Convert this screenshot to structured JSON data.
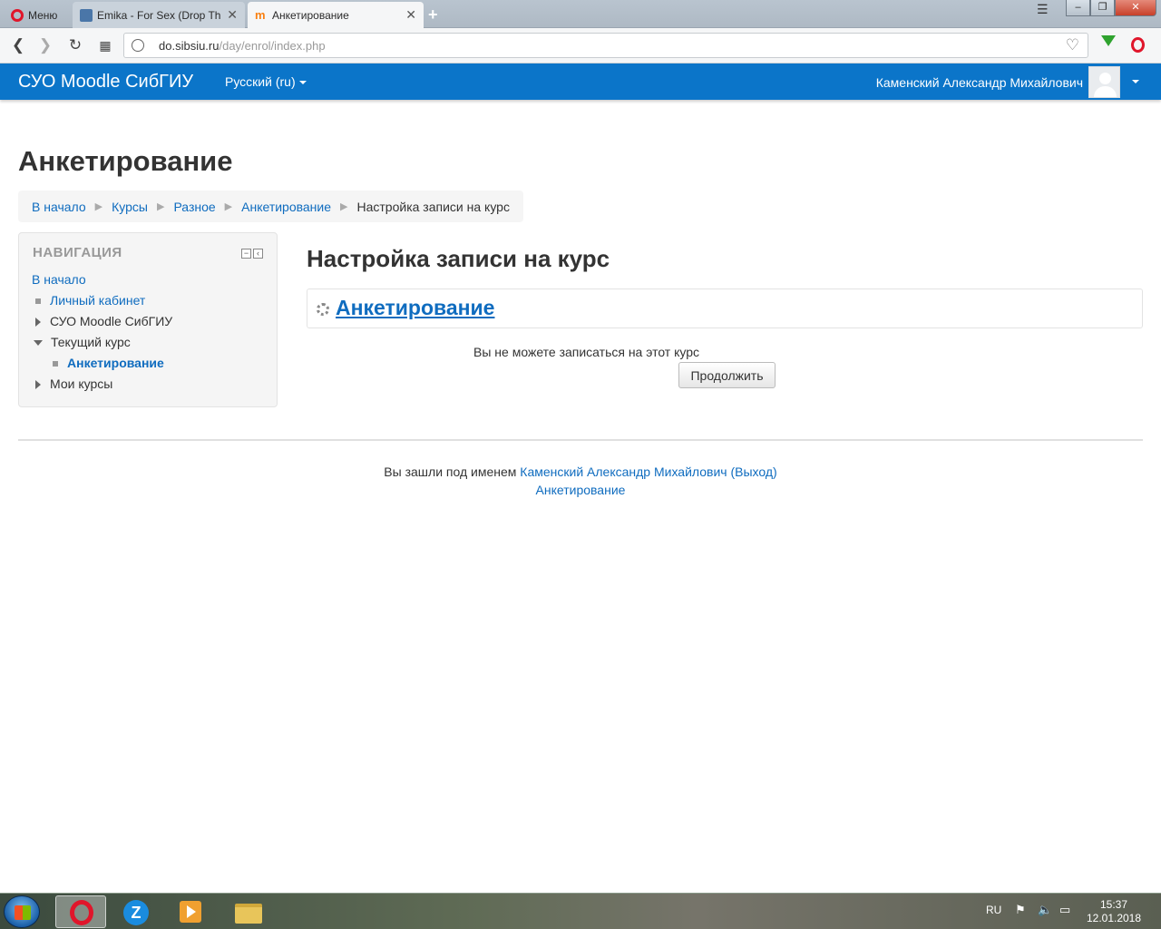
{
  "browser": {
    "menu_label": "Меню",
    "tabs": [
      {
        "title": "Emika - For Sex (Drop The"
      },
      {
        "title": "Анкетирование"
      }
    ],
    "url_domain": "do.sibsiu.ru",
    "url_path": "/day/enrol/index.php",
    "url_prefix": "",
    "win_minimize": "–",
    "win_restore": "❐",
    "win_close": "✕"
  },
  "navbar": {
    "brand": "СУО Moodle СибГИУ",
    "language": "Русский (ru)",
    "user_name": "Каменский Александр Михайлович"
  },
  "page": {
    "title": "Анкетирование",
    "breadcrumb": [
      "В начало",
      "Курсы",
      "Разное",
      "Анкетирование",
      "Настройка записи на курс"
    ]
  },
  "navigation_block": {
    "title": "НАВИГАЦИЯ",
    "items": [
      {
        "label": "В начало"
      },
      {
        "label": "Личный кабинет"
      },
      {
        "label": "СУО Moodle СибГИУ"
      },
      {
        "label": "Текущий курс"
      },
      {
        "label": "Анкетирование"
      },
      {
        "label": "Мои курсы"
      }
    ]
  },
  "main": {
    "heading": "Настройка записи на курс",
    "course_name": "Анкетирование",
    "notice": "Вы не можете записаться на этот курс",
    "continue_label": "Продолжить"
  },
  "footer": {
    "logged_in_prefix": "Вы зашли под именем",
    "user_link": "Каменский Александр Михайлович",
    "logout_link": "(Выход)",
    "course_link": "Анкетирование"
  },
  "taskbar": {
    "language": "RU",
    "time": "15:37",
    "date": "12.01.2018"
  }
}
